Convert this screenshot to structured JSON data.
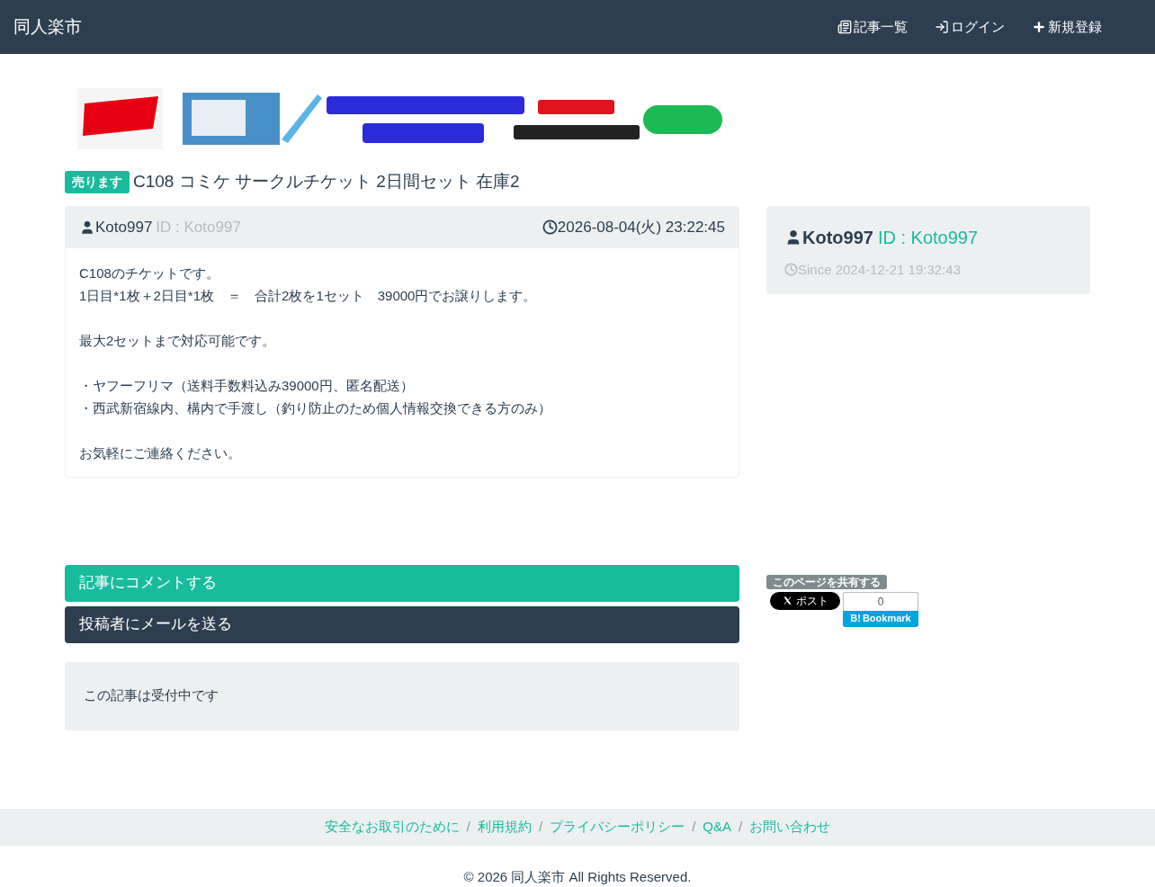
{
  "navbar": {
    "brand": "同人楽市",
    "links": [
      {
        "kind": "list",
        "label": "記事一覧"
      },
      {
        "kind": "login",
        "label": "ログイン"
      },
      {
        "kind": "plus",
        "label": "新規登録"
      }
    ]
  },
  "post": {
    "badge": "売ります",
    "title": "C108 コミケ サークルチケット 2日間セット 在庫2",
    "author": "Koto997",
    "author_id": "ID : Koto997",
    "date": "2026-08-04(火) 23:22:45",
    "body": [
      [
        "C108のチケットです。",
        "1日目*1枚＋2日目*1枚　＝　合計2枚を1セット　39000円でお譲りします。"
      ],
      [
        "最大2セットまで対応可能です。"
      ],
      [
        "・ヤフーフリマ（送料手数料込み39000円、匿名配送）",
        "・西武新宿線内、構内で手渡し（釣り防止のため個人情報交換できる方のみ）"
      ],
      [
        "お気軽にご連絡ください。"
      ]
    ]
  },
  "profile": {
    "name": "Koto997",
    "id": "ID : Koto997",
    "since": "Since 2024-12-21 19:32:43"
  },
  "actions": [
    {
      "kind": "comment",
      "label": "記事にコメントする"
    },
    {
      "kind": "mail",
      "label": "投稿者にメールを送る"
    }
  ],
  "status": "この記事は受付中です",
  "share": {
    "label": "このページを共有する",
    "x_post": "ポスト",
    "bookmark_count": "0",
    "bookmark_mark": "B!",
    "bookmark_label": "Bookmark"
  },
  "footer": {
    "separator": "/",
    "links": [
      "安全なお取引のために",
      "利用規約",
      "プライバシーポリシー",
      "Q&A",
      "お問い合わせ"
    ],
    "copyright": "© 2026 同人楽市 All Rights Reserved."
  }
}
